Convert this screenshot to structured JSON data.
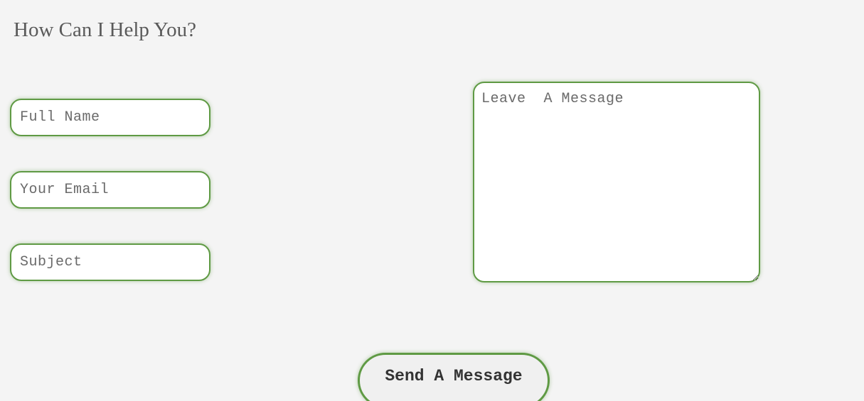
{
  "heading": "How Can I Help You?",
  "form": {
    "full_name": {
      "value": "",
      "placeholder": "Full Name"
    },
    "email": {
      "value": "",
      "placeholder": "Your Email"
    },
    "subject": {
      "value": "",
      "placeholder": "Subject"
    },
    "message": {
      "value": "",
      "placeholder": "Leave  A Message"
    },
    "submit_label": "Send A Message"
  },
  "colors": {
    "background": "#f4f4f4",
    "accent_border": "#5f9a44",
    "field_background": "#ffffff",
    "heading_text": "#5a5a5a",
    "button_text": "#333333"
  }
}
